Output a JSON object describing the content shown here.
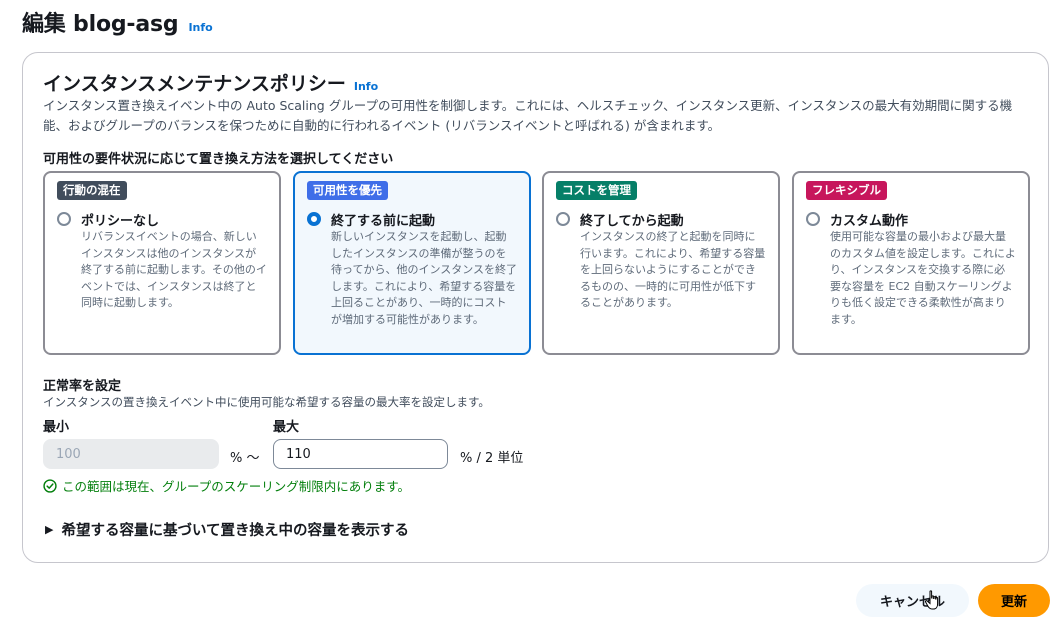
{
  "header": {
    "title": "編集 blog-asg",
    "info": "Info"
  },
  "section": {
    "title": "インスタンスメンテナンスポリシー",
    "info": "Info",
    "description": "インスタンス置き換えイベント中の Auto Scaling グループの可用性を制御します。これには、ヘルスチェック、インスタンス更新、インスタンスの最大有効期間に関する機能、およびグループのバランスを保つために自動的に行われるイベント (リバランスイベントと呼ばれる) が含まれます。",
    "choose_label": "可用性の要件状況に応じて置き換え方法を選択してください"
  },
  "options": [
    {
      "badge": "行動の混在",
      "badge_color": "#414d5c",
      "title": "ポリシーなし",
      "selected": false,
      "description": "リバランスイベントの場合、新しいインスタンスは他のインスタンスが終了する前に起動します。その他のイベントでは、インスタンスは終了と同時に起動します。"
    },
    {
      "badge": "可用性を優先",
      "badge_color": "#3f6ee8",
      "title": "終了する前に起動",
      "selected": true,
      "description": "新しいインスタンスを起動し、起動したインスタンスの準備が整うのを待ってから、他のインスタンスを終了します。これにより、希望する容量を上回ることがあり、一時的にコストが増加する可能性があります。"
    },
    {
      "badge": "コストを管理",
      "badge_color": "#067f68",
      "title": "終了してから起動",
      "selected": false,
      "description": "インスタンスの終了と起動を同時に行います。これにより、希望する容量を上回らないようにすることができるものの、一時的に可用性が低下することがあります。"
    },
    {
      "badge": "フレキシブル",
      "badge_color": "#c7165c",
      "title": "カスタム動作",
      "selected": false,
      "description": "使用可能な容量の最小および最大量のカスタム値を設定します。これにより、インスタンスを交換する際に必要な容量を EC2 自動スケーリングよりも低く設定できる柔軟性が高まります。"
    }
  ],
  "health": {
    "title": "正常率を設定",
    "description": "インスタンスの置き換えイベント中に使用可能な希望する容量の最大率を設定します。",
    "min_label": "最小",
    "min_value": "100",
    "separator": "% ～",
    "max_label": "最大",
    "max_value": "110",
    "unit": "% / 2 単位",
    "status": "この範囲は現在、グループのスケーリング制限内にあります。",
    "status_color": "#037f0c"
  },
  "expander": {
    "label": "希望する容量に基づいて置き換え中の容量を表示する"
  },
  "footer": {
    "cancel": "キャンセル",
    "submit": "更新"
  },
  "colors": {
    "accent": "#0972d3",
    "primary_button": "#ff9900"
  }
}
